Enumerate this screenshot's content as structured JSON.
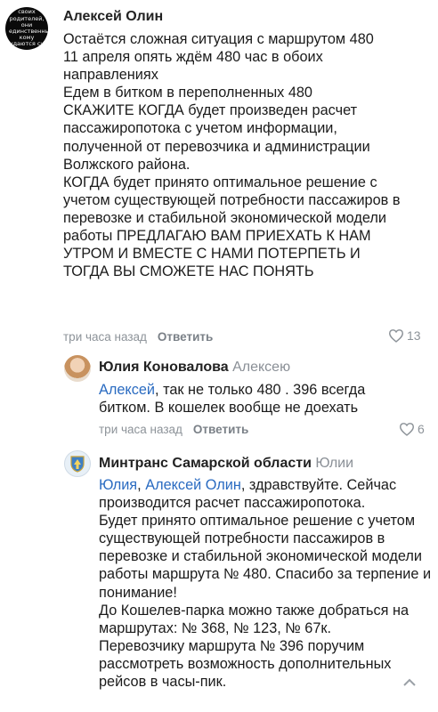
{
  "comments": [
    {
      "avatar_text": "своих родителей, они единственных, кому удаются сч",
      "author": "Алексей Олин",
      "reply_to": "",
      "mentions": [],
      "text": "Остаётся сложная ситуация с маршрутом 480\n11 апреля опять ждём 480 час в обоих направлениях\nЕдем в битком в переполненных 480\nСКАЖИТЕ КОГДА будет произведен расчет пассажиропотока с учетом информации, полученной от перевозчика и администрации Волжского района.\nКОГДА будет принято оптимальное решение с учетом существующей потребности пассажиров в перевозке и стабильной экономической модели работы ПРЕДЛАГАЮ ВАМ ПРИЕХАТЬ К НАМ УТРОМ  И ВМЕСТЕ С НАМИ ПОТЕРПЕТЬ  И ТОГДА ВЫ СМОЖЕТЕ НАС ПОНЯТЬ",
      "time": "три часа назад",
      "reply_label": "Ответить",
      "likes": "13"
    },
    {
      "author": "Юлия Коновалова",
      "reply_to": "Алексею",
      "mentions": [
        "Алексей"
      ],
      "text": ", так не только 480 . 396 всегда битком. В кошелек вообще не доехать",
      "time": "три часа назад",
      "reply_label": "Ответить",
      "likes": "6"
    },
    {
      "author": "Минтранс Самарской области",
      "reply_to": "Юлии",
      "mentions": [
        "Юлия",
        "Алексей Олин"
      ],
      "text": ", здравствуйте. Сейчас производится расчет пассажиропотока.\nБудет принято оптимальное решение с учетом существующей потребности пассажиров в перевозке и стабильной экономической модели работы маршрута № 480. Спасибо за терпение и понимание!\nДо Кошелев-парка можно также добраться на маршрутах: № 368, № 123, № 67к.\nПеревозчику маршрута № 396 поручим рассмотреть возможность дополнительных рейсов в часы-пик."
    }
  ],
  "colors": {
    "mention": "#2a6bc1",
    "meta": "#8d9399"
  },
  "icons": {
    "like": "heart-outline-icon",
    "scroll": "chevron-up-icon"
  }
}
